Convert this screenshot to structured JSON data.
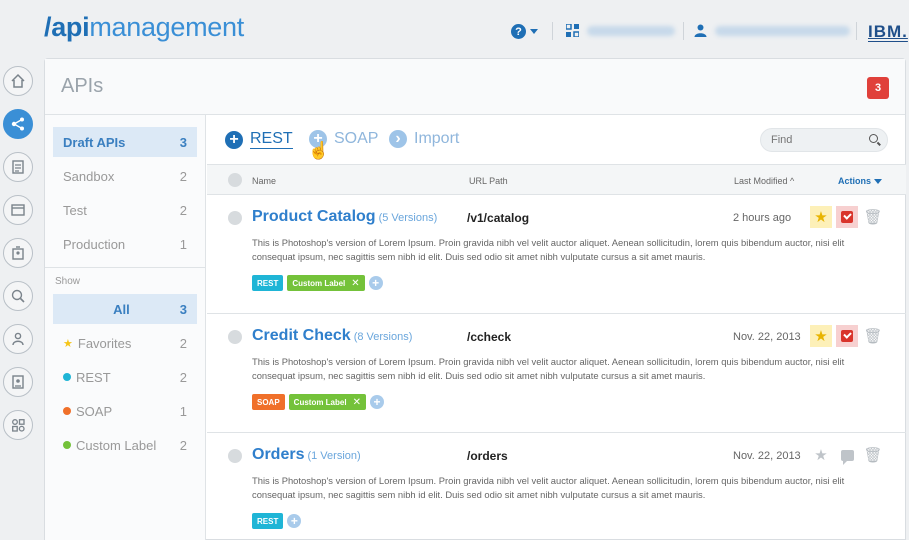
{
  "header": {
    "logo_slash": "/",
    "logo_bold": "api",
    "logo_rest": "management",
    "help_label": "?",
    "brand": "IBM."
  },
  "page": {
    "title": "APIs",
    "notification_count": "3"
  },
  "filters": {
    "groups": [
      {
        "label": "Draft APIs",
        "count": "3"
      },
      {
        "label": "Sandbox",
        "count": "2"
      },
      {
        "label": "Test",
        "count": "2"
      },
      {
        "label": "Production",
        "count": "1"
      }
    ],
    "show_label": "Show",
    "types": [
      {
        "label": "All",
        "count": "3"
      },
      {
        "label": "Favorites",
        "count": "2"
      },
      {
        "label": "REST",
        "count": "2",
        "color": "#1fb5d6"
      },
      {
        "label": "SOAP",
        "count": "1",
        "color": "#f0702a"
      },
      {
        "label": "Custom Label",
        "count": "2",
        "color": "#74c23a"
      }
    ]
  },
  "toolbar": {
    "rest_label": "REST",
    "soap_label": "SOAP",
    "import_label": "Import",
    "add_icon": "+",
    "import_icon": "›",
    "find_placeholder": "Find"
  },
  "columns": {
    "name": "Name",
    "url": "URL Path",
    "modified": "Last Modified",
    "actions": "Actions"
  },
  "apis": [
    {
      "name": "Product Catalog",
      "versions": "(5 Versions)",
      "path": "/v1/catalog",
      "modified": "2 hours ago",
      "description": "This is Photoshop's version  of Lorem Ipsum. Proin gravida nibh vel velit auctor aliquet. Aenean sollicitudin, lorem quis bibendum auctor, nisi elit consequat ipsum, nec sagittis sem nibh id elit. Duis sed odio sit amet nibh vulputate cursus a sit amet mauris.",
      "tag_type": "REST",
      "tag_custom": "Custom Label"
    },
    {
      "name": "Credit Check",
      "versions": "(8 Versions)",
      "path": "/ccheck",
      "modified": "Nov. 22, 2013",
      "description": "This is Photoshop's version  of Lorem Ipsum. Proin gravida nibh vel velit auctor aliquet. Aenean sollicitudin, lorem quis bibendum auctor, nisi elit consequat ipsum, nec sagittis sem nibh id elit. Duis sed odio sit amet nibh vulputate cursus a sit amet mauris.",
      "tag_type": "SOAP",
      "tag_custom": "Custom Label"
    },
    {
      "name": "Orders",
      "versions": "(1 Version)",
      "path": "/orders",
      "modified": "Nov. 22, 2013",
      "description": "This is Photoshop's version  of Lorem Ipsum. Proin gravida nibh vel velit auctor aliquet. Aenean sollicitudin, lorem quis bibendum auctor, nisi elit consequat ipsum, nec sagittis sem nibh id elit. Duis sed odio sit amet nibh vulputate cursus a sit amet mauris.",
      "tag_type": "REST"
    }
  ],
  "icons": {
    "star": "★",
    "trash": "🗑",
    "remove_tag": "✕",
    "pointer": "☝",
    "sort_up": "^"
  }
}
